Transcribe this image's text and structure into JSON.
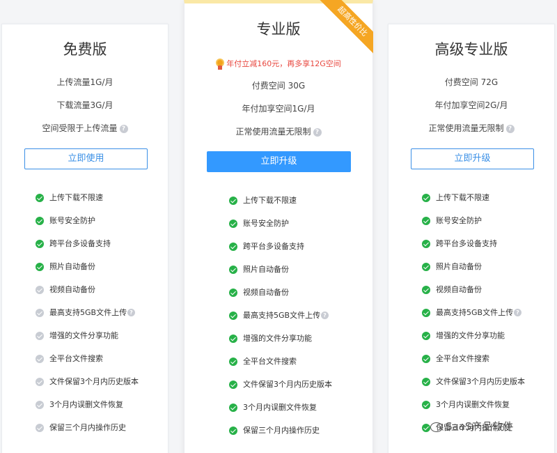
{
  "plans": {
    "free": {
      "title": "免费版",
      "info": [
        "上传流量1G/月",
        "下载流量3G/月",
        "空间受限于上传流量"
      ],
      "button": "立即使用"
    },
    "pro": {
      "title": "专业版",
      "ribbon": "超高性价比",
      "promo": "年付立减160元，再多享12G空间",
      "info": [
        "付费空间 30G",
        "年付加享空间1G/月",
        "正常使用流量无限制"
      ],
      "button": "立即升级"
    },
    "premium": {
      "title": "高级专业版",
      "info": [
        "付费空间 72G",
        "年付加享空间2G/月",
        "正常使用流量无限制"
      ],
      "button": "立即升级"
    }
  },
  "features": [
    "上传下载不限速",
    "账号安全防护",
    "跨平台多设备支持",
    "照片自动备份",
    "视频自动备份",
    "最高支持5GB文件上传",
    "增强的文件分享功能",
    "全平台文件搜索",
    "文件保留3个月内历史版本",
    "3个月内误删文件恢复",
    "保留三个月内操作历史"
  ],
  "free_enabled": [
    true,
    true,
    true,
    true,
    false,
    false,
    false,
    false,
    false,
    false,
    false
  ],
  "colors": {
    "check_on": "#27b148",
    "check_off": "#c8ccd3",
    "primary": "#3399ff",
    "ribbon": "#f5a623",
    "promo": "#e8473f"
  },
  "icons": {
    "help": "question-circle-icon",
    "check": "check-circle-icon",
    "medal": "medal-icon"
  },
  "watermark": "SaaS产品软件"
}
